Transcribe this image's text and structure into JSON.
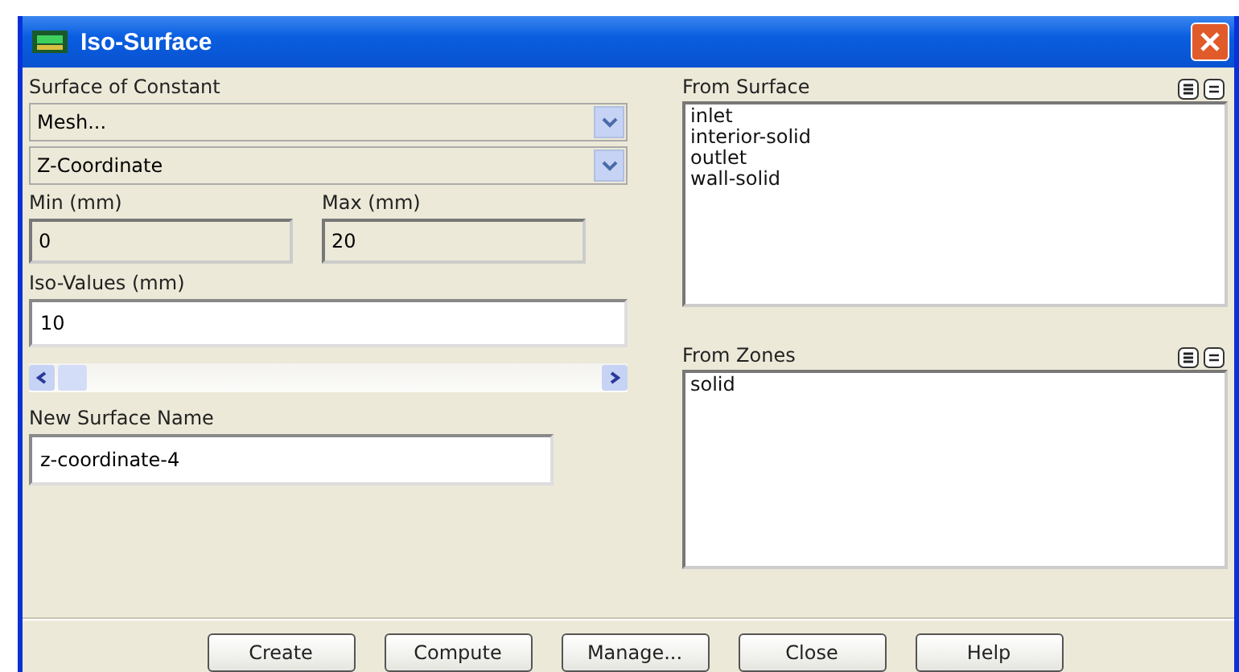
{
  "window": {
    "title": "Iso-Surface"
  },
  "surface_of_constant": {
    "label": "Surface of Constant",
    "category": "Mesh...",
    "quantity": "Z-Coordinate"
  },
  "min": {
    "label": "Min (mm)",
    "value": "0"
  },
  "max": {
    "label": "Max (mm)",
    "value": "20"
  },
  "iso_values": {
    "label": "Iso-Values (mm)",
    "value": "10"
  },
  "new_surface_name": {
    "label": "New Surface Name",
    "value": "z-coordinate-4"
  },
  "from_surface": {
    "label": "From Surface",
    "items": [
      {
        "label": "inlet",
        "selected": false
      },
      {
        "label": "interior-solid",
        "selected": false
      },
      {
        "label": "outlet",
        "selected": false
      },
      {
        "label": "wall-solid",
        "selected": false
      }
    ]
  },
  "from_zones": {
    "label": "From Zones",
    "items": [
      {
        "label": "solid",
        "selected": false
      }
    ]
  },
  "buttons": [
    "Create",
    "Compute",
    "Manage...",
    "Close",
    "Help"
  ]
}
